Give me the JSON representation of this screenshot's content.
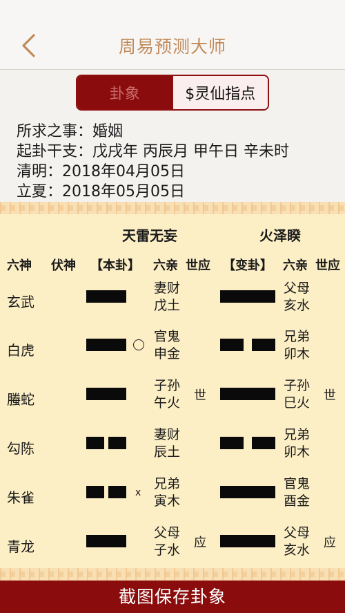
{
  "app": {
    "title": "周易预测大师"
  },
  "segment": {
    "left_label": "卦象",
    "right_label": "$灵仙指点"
  },
  "info": {
    "matter_label": "所求之事：",
    "matter_value": "婚姻",
    "time_label": "起卦干支：",
    "time_value": "戊戌年 丙辰月 甲午日 辛未时",
    "term1_label": "清明：",
    "term1_value": "2018年04月05日",
    "term2_label": "立夏：",
    "term2_value": "2018年05月05日"
  },
  "hexagram": {
    "main_name": "天雷无妄",
    "changed_name": "火泽睽",
    "headers": {
      "spirit": "六神",
      "hidden": "伏神",
      "main": "【本卦】",
      "relation": "六亲",
      "world": "世应",
      "changed": "【变卦】",
      "relation2": "六亲",
      "world2": "世应"
    },
    "rows": [
      {
        "spirit": "玄武",
        "main_line": "yang",
        "main_mark": "",
        "rel1": "妻财",
        "rel2": "戊土",
        "world": "",
        "changed_line": "yang",
        "crel1": "父母",
        "crel2": "亥水",
        "cworld": ""
      },
      {
        "spirit": "白虎",
        "main_line": "yang",
        "main_mark": "circle",
        "rel1": "官鬼",
        "rel2": "申金",
        "world": "",
        "changed_line": "yin",
        "crel1": "兄弟",
        "crel2": "卯木",
        "cworld": ""
      },
      {
        "spirit": "螣蛇",
        "main_line": "yang",
        "main_mark": "",
        "rel1": "子孙",
        "rel2": "午火",
        "world": "世",
        "changed_line": "yang",
        "crel1": "子孙",
        "crel2": "巳火",
        "cworld": "世"
      },
      {
        "spirit": "勾陈",
        "main_line": "yin",
        "main_mark": "",
        "rel1": "妻财",
        "rel2": "辰土",
        "world": "",
        "changed_line": "yin",
        "crel1": "兄弟",
        "crel2": "卯木",
        "cworld": ""
      },
      {
        "spirit": "朱雀",
        "main_line": "yin",
        "main_mark": "x",
        "rel1": "兄弟",
        "rel2": "寅木",
        "world": "",
        "changed_line": "yang",
        "crel1": "官鬼",
        "crel2": "酉金",
        "cworld": ""
      },
      {
        "spirit": "青龙",
        "main_line": "yang",
        "main_mark": "",
        "rel1": "父母",
        "rel2": "子水",
        "world": "应",
        "changed_line": "yang",
        "crel1": "父母",
        "crel2": "亥水",
        "cworld": "应"
      }
    ]
  },
  "footer": {
    "save_label": "截图保存卦象"
  },
  "colors": {
    "accent": "#8a0c0c",
    "title": "#c08a5a",
    "board": "#fcefc6"
  }
}
